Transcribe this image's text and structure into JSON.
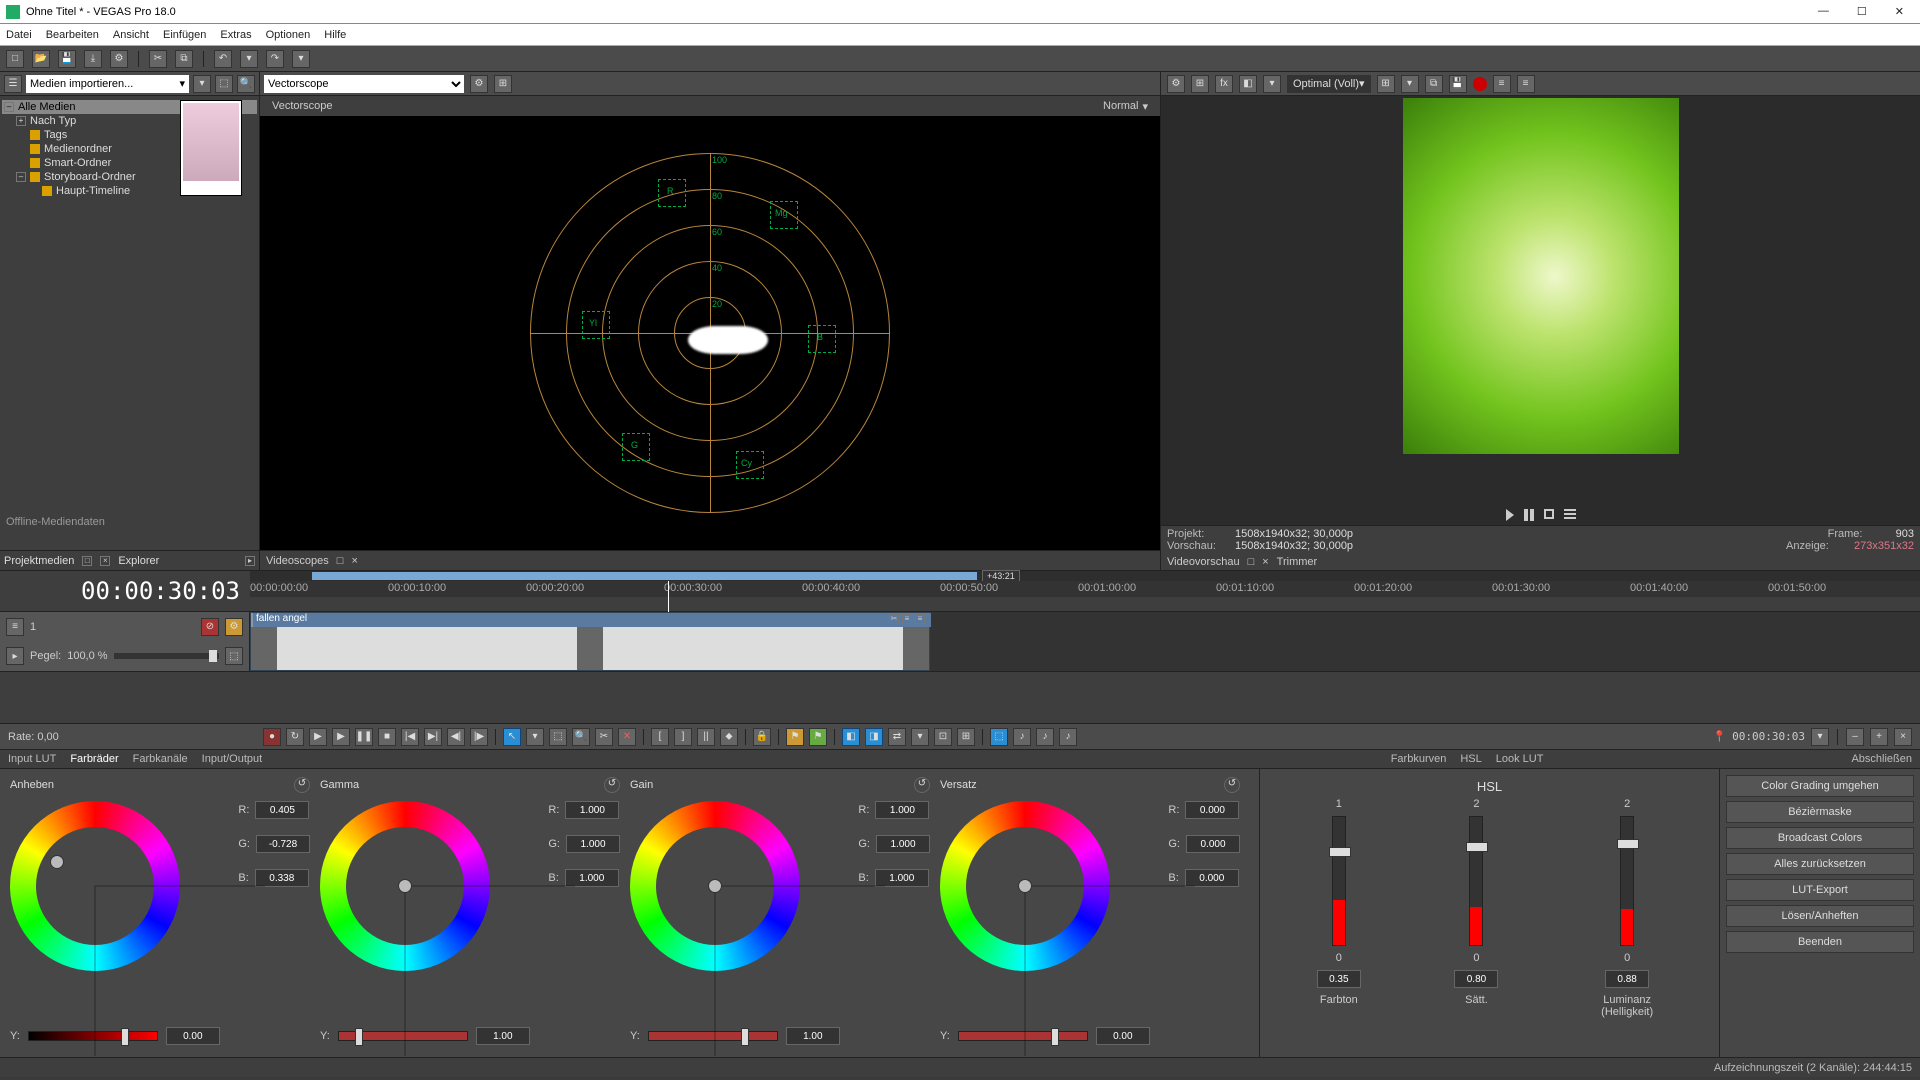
{
  "window": {
    "title": "Ohne Titel * - VEGAS Pro 18.0"
  },
  "menu": [
    "Datei",
    "Bearbeiten",
    "Ansicht",
    "Einfügen",
    "Extras",
    "Optionen",
    "Hilfe"
  ],
  "projectMedia": {
    "dropdown": "Medien importieren...",
    "tree": [
      {
        "label": "Alle Medien",
        "sel": true
      },
      {
        "label": "Nach Typ"
      },
      {
        "label": "Tags"
      },
      {
        "label": "Medienordner"
      },
      {
        "label": "Smart-Ordner"
      },
      {
        "label": "Storyboard-Ordner"
      },
      {
        "label": "Haupt-Timeline"
      }
    ],
    "offline": "Offline-Mediendaten",
    "tabs": {
      "project": "Projektmedien",
      "explorer": "Explorer"
    }
  },
  "scope": {
    "type": "Vectorscope",
    "label": "Vectorscope",
    "mode": "Normal",
    "tab": "Videoscopes",
    "targets": [
      "R",
      "Mg",
      "B",
      "Cy",
      "G",
      "Yl"
    ],
    "rings": [
      "100",
      "80",
      "60",
      "40",
      "20"
    ]
  },
  "preview": {
    "quality": "Optimal (Voll)",
    "info": {
      "projekt_k": "Projekt:",
      "projekt_v": "1508x1940x32; 30,000p",
      "vorschau_k": "Vorschau:",
      "vorschau_v": "1508x1940x32; 30,000p",
      "frame_k": "Frame:",
      "frame_v": "903",
      "anzeige_k": "Anzeige:",
      "anzeige_v": "273x351x32",
      "vtab": "Videovorschau",
      "trimmer": "Trimmer"
    }
  },
  "timeline": {
    "tc": "00:00:30:03",
    "zoom_end": "+43:21",
    "marks": [
      "00:00:00:00",
      "00:00:10:00",
      "00:00:20:00",
      "00:00:30:00",
      "00:00:40:00",
      "00:00:50:00",
      "00:01:00:00",
      "00:01:10:00",
      "00:01:20:00",
      "00:01:30:00",
      "00:01:40:00",
      "00:01:50:00"
    ],
    "track": {
      "pegel_k": "Pegel:",
      "pegel_v": "100,0 %",
      "clip": "fallen angel",
      "num": "1"
    },
    "rate": "Rate: 0,00",
    "tc2": "00:00:30:03"
  },
  "cg": {
    "tabs_l": [
      "Input LUT",
      "Farbräder",
      "Farbkanäle",
      "Input/Output"
    ],
    "tabs_r": [
      "Farbkurven",
      "HSL",
      "Look LUT"
    ],
    "tabs_far": "Abschließen",
    "wheels": [
      {
        "name": "Anheben",
        "r": "0.405",
        "g": "-0.728",
        "b": "0.338",
        "y": "0.00",
        "dot": {
          "l": 40,
          "t": 54
        },
        "hnd": 92
      },
      {
        "name": "Gamma",
        "r": "1.000",
        "g": "1.000",
        "b": "1.000",
        "y": "1.00",
        "dot": {
          "l": 78,
          "t": 78
        },
        "hnd": 16
      },
      {
        "name": "Gain",
        "r": "1.000",
        "g": "1.000",
        "b": "1.000",
        "y": "1.00",
        "dot": {
          "l": 78,
          "t": 78
        },
        "hnd": 92
      },
      {
        "name": "Versatz",
        "r": "0.000",
        "g": "0.000",
        "b": "0.000",
        "y": "0.00",
        "dot": {
          "l": 78,
          "t": 78
        },
        "hnd": 92
      }
    ],
    "hsl": {
      "title": "HSL",
      "cols": [
        {
          "n": "1",
          "v": "0.35",
          "lbl": "Farbton",
          "zero": "0",
          "fill": 35,
          "hnd": 88
        },
        {
          "n": "2",
          "v": "0.80",
          "lbl": "Sätt.",
          "zero": "0",
          "fill": 30,
          "hnd": 93
        },
        {
          "n": "2",
          "v": "0.88",
          "lbl": "Luminanz (Helligkeit)",
          "zero": "0",
          "fill": 28,
          "hnd": 96
        }
      ]
    },
    "side": [
      "Color Grading umgehen",
      "Bézièrmaske",
      "Broadcast Colors",
      "Alles zurücksetzen",
      "LUT-Export",
      "Lösen/Anheften",
      "Beenden"
    ]
  },
  "status": "Aufzeichnungszeit (2 Kanäle): 244:44:15"
}
